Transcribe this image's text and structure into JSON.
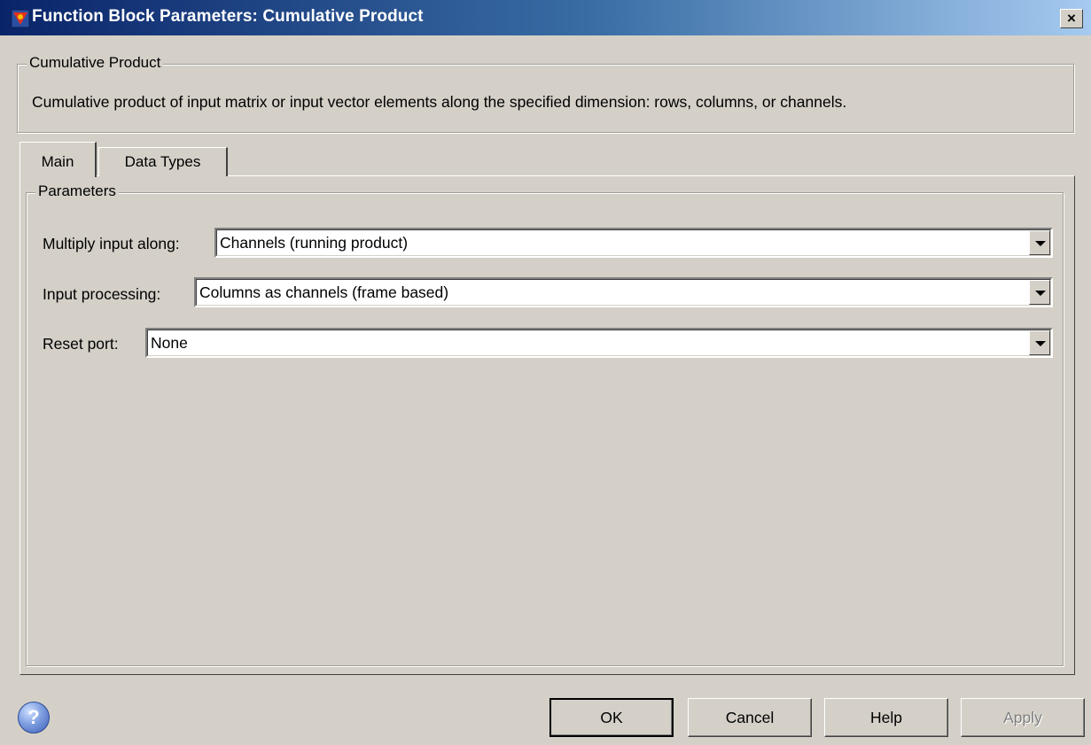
{
  "window": {
    "title": "Function Block Parameters: Cumulative Product",
    "close_label": "×"
  },
  "block": {
    "group_title": "Cumulative Product",
    "description": "Cumulative product of input matrix or input vector elements along the specified dimension: rows, columns, or channels."
  },
  "tabs": [
    {
      "label": "Main",
      "active": true
    },
    {
      "label": "Data Types",
      "active": false
    }
  ],
  "parameters": {
    "group_title": "Parameters",
    "fields": [
      {
        "label": "Multiply input along:",
        "value": "Channels (running product)"
      },
      {
        "label": "Input processing:",
        "value": "Columns as channels (frame based)"
      },
      {
        "label": "Reset port:",
        "value": "None"
      }
    ]
  },
  "buttons": {
    "help_icon_glyph": "?",
    "ok": "OK",
    "cancel": "Cancel",
    "help": "Help",
    "apply": "Apply"
  },
  "icons": [
    "simulink-block-icon",
    "close-icon",
    "help-icon",
    "chevron-down-icon"
  ]
}
